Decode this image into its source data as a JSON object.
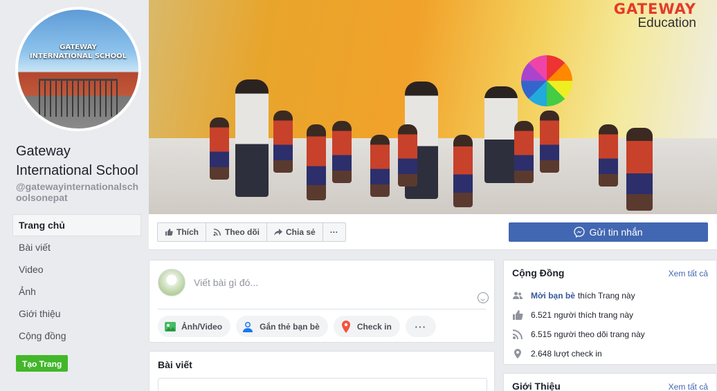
{
  "sidebar": {
    "avatar_text_line1": "GATEWAY",
    "avatar_text_line2": "INTERNATIONAL SCHOOL",
    "page_name": "Gateway International School",
    "page_handle": "@gatewayinternationalschoolsonepat",
    "nav": [
      {
        "label": "Trang chủ",
        "active": true
      },
      {
        "label": "Bài viết"
      },
      {
        "label": "Video"
      },
      {
        "label": "Ảnh"
      },
      {
        "label": "Giới thiệu"
      },
      {
        "label": "Cộng đồng"
      }
    ],
    "create_page_label": "Tạo Trang"
  },
  "cover": {
    "brand_line1": "GATEWAY",
    "brand_line2": "Education"
  },
  "actions": {
    "like_label": "Thích",
    "follow_label": "Theo dõi",
    "share_label": "Chia sẻ",
    "more_label": "···",
    "send_message_label": "Gửi tin nhắn"
  },
  "composer": {
    "placeholder": "Viết bài gì đó...",
    "photo_video_label": "Ảnh/Video",
    "tag_friends_label": "Gắn thẻ bạn bè",
    "check_in_label": "Check in",
    "more_label": "···"
  },
  "posts": {
    "title": "Bài viết"
  },
  "community": {
    "title": "Cộng Đồng",
    "see_all": "Xem tất cả",
    "invite_strong": "Mời bạn bè",
    "invite_rest": "thích Trang này",
    "likes": "6.521 người thích trang này",
    "follows": "6.515 người theo dõi trang này",
    "checkins": "2.648 lượt check in"
  },
  "about": {
    "title": "Giới Thiệu",
    "see_all": "Xem tất cả"
  },
  "colors": {
    "accent": "#4267b2",
    "link": "#365899",
    "create_button": "#42b72a",
    "background": "#e9ebee"
  }
}
